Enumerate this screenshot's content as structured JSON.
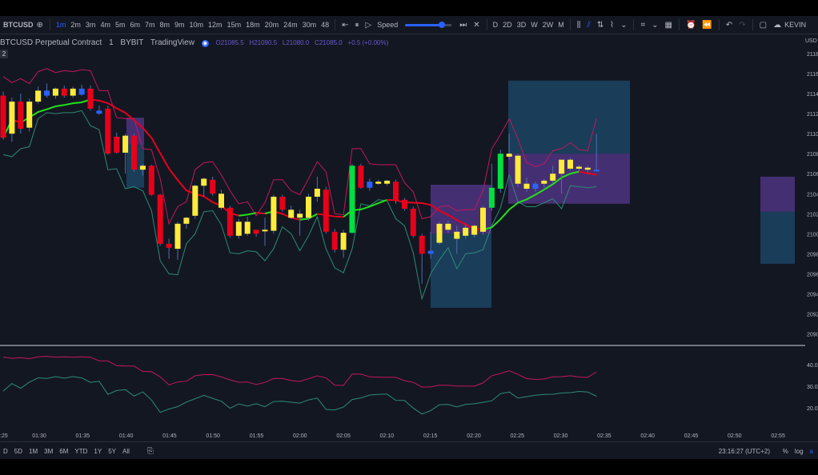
{
  "toolbar": {
    "symbol": "BTCUSD",
    "intervals": [
      "1m",
      "2m",
      "3m",
      "4m",
      "5m",
      "6m",
      "7m",
      "8m",
      "9m",
      "10m",
      "12m",
      "15m",
      "18m",
      "20m",
      "24m",
      "30m",
      "48"
    ],
    "active_interval": "1m",
    "speed_label": "Speed",
    "ranges_right": [
      "D",
      "2D",
      "3D",
      "W",
      "2W",
      "M"
    ],
    "account": "KEVIN"
  },
  "legend": {
    "title": "BTCUSD Perpetual Contract",
    "interval": "1",
    "exchange": "BYBIT",
    "source": "TradingView",
    "open": "O21085.5",
    "high": "H21090.5",
    "low": "L21080.0",
    "close": "C21085.0",
    "change": "+0.5 (+0.00%)",
    "pane_badge": "2"
  },
  "price_axis": {
    "currency": "USD",
    "ticks": [
      "2118",
      "2116",
      "2114",
      "2112",
      "2110",
      "2108",
      "2106",
      "2104",
      "2102",
      "2100",
      "2098",
      "2096",
      "2094",
      "2092",
      "2090"
    ]
  },
  "indicator_axis": {
    "ticks": [
      "40.0",
      "30.0",
      "20.0"
    ]
  },
  "time_axis": {
    "ticks": [
      ":25",
      "01:30",
      "01:35",
      "01:40",
      "01:45",
      "01:50",
      "01:55",
      "02:00",
      "02:05",
      "02:10",
      "02:15",
      "02:20",
      "02:25",
      "02:30",
      "02:35",
      "02:40",
      "02:45",
      "02:50",
      "02:55"
    ]
  },
  "bottom": {
    "ranges": [
      "D",
      "5D",
      "1M",
      "3M",
      "6M",
      "YTD",
      "1Y",
      "5Y",
      "All"
    ],
    "clock": "23:16:27 (UTC+2)",
    "percent": "%",
    "log": "log",
    "auto": "a"
  },
  "colors": {
    "background": "#131722",
    "candle_yellow": "#ffeb3b",
    "candle_red": "#e8001a",
    "candle_green": "#00e040",
    "candle_blue": "#2962ff",
    "ma_red": "#e6001c",
    "ma_green": "#22e01c",
    "band": "#c2185b",
    "band_lower": "#2e8b74",
    "box_blue": "#1e4f72",
    "box_purple": "#5b3a96"
  },
  "chart_data": {
    "type": "candlestick",
    "ylim": [
      2089,
      2120
    ],
    "times": [
      "01:25",
      "01:26",
      "01:27",
      "01:28",
      "01:29",
      "01:30",
      "01:31",
      "01:32",
      "01:33",
      "01:34",
      "01:35",
      "01:36",
      "01:37",
      "01:38",
      "01:39",
      "01:40",
      "01:41",
      "01:42",
      "01:43",
      "01:44",
      "01:45",
      "01:46",
      "01:47",
      "01:48",
      "01:49",
      "01:50",
      "01:51",
      "01:52",
      "01:53",
      "01:54",
      "01:55",
      "01:56",
      "01:57",
      "01:58",
      "01:59",
      "02:00",
      "02:01",
      "02:02",
      "02:03",
      "02:04",
      "02:05",
      "02:06",
      "02:07",
      "02:08",
      "02:09",
      "02:10",
      "02:11",
      "02:12",
      "02:13",
      "02:14",
      "02:15",
      "02:16",
      "02:17",
      "02:18",
      "02:19",
      "02:20",
      "02:21",
      "02:22",
      "02:23",
      "02:24",
      "02:25",
      "02:26",
      "02:27",
      "02:28",
      "02:29",
      "02:30",
      "02:31",
      "02:32",
      "02:33"
    ],
    "candles": [
      [
        2113.8,
        2114.2,
        2109.4,
        2109.6,
        "red"
      ],
      [
        2110,
        2113.6,
        2109.2,
        2113.2,
        "yellow"
      ],
      [
        2113.2,
        2114,
        2110,
        2110.5,
        "red"
      ],
      [
        2110.6,
        2113.5,
        2110.2,
        2113.2,
        "yellow"
      ],
      [
        2113.2,
        2114.7,
        2113.0,
        2114.3,
        "yellow"
      ],
      [
        2114.3,
        2115,
        2113.6,
        2113.8,
        "blue"
      ],
      [
        2113.8,
        2114.6,
        2113.5,
        2114.5,
        "yellow"
      ],
      [
        2114.5,
        2114.8,
        2113.6,
        2113.8,
        "red"
      ],
      [
        2113.8,
        2114.7,
        2113.6,
        2114.5,
        "yellow"
      ],
      [
        2114.5,
        2114.9,
        2113.8,
        2113.9,
        "blue"
      ],
      [
        2114.5,
        2114.8,
        2112.3,
        2112.5,
        "red"
      ],
      [
        2112.3,
        2112.8,
        2111.9,
        2112.0,
        "blue"
      ],
      [
        2112.5,
        2112.8,
        2107.9,
        2108.0,
        "red"
      ],
      [
        2109.7,
        2110.1,
        2108.0,
        2108.1,
        "red"
      ],
      [
        2108.1,
        2110.0,
        2106.0,
        2109.8,
        "yellow"
      ],
      [
        2109.8,
        2110.0,
        2106.2,
        2106.4,
        "red"
      ],
      [
        2106.4,
        2107.0,
        2105.8,
        2106.8,
        "yellow"
      ],
      [
        2106.8,
        2106.9,
        2103.8,
        2103.9,
        "red"
      ],
      [
        2103.9,
        2104.0,
        2098.8,
        2099.0,
        "red"
      ],
      [
        2099.0,
        2099.5,
        2097.5,
        2098.6,
        "red"
      ],
      [
        2098.5,
        2101.2,
        2097.4,
        2101.0,
        "yellow"
      ],
      [
        2101.0,
        2101.7,
        2100.5,
        2101.6,
        "yellow"
      ],
      [
        2101.8,
        2104.9,
        2101.5,
        2104.8,
        "yellow"
      ],
      [
        2104.8,
        2105.6,
        2103.7,
        2105.5,
        "yellow"
      ],
      [
        2105.4,
        2105.7,
        2103.8,
        2104.0,
        "red"
      ],
      [
        2104.0,
        2104.4,
        2102.4,
        2102.6,
        "yellow"
      ],
      [
        2102.6,
        2102.8,
        2099.6,
        2099.8,
        "red"
      ],
      [
        2099.8,
        2101.5,
        2099.5,
        2101.2,
        "yellow"
      ],
      [
        2101.2,
        2101.7,
        2099.8,
        2100.0,
        "yellow"
      ],
      [
        2100.0,
        2100.3,
        2099.7,
        2100.4,
        "red"
      ],
      [
        2100.4,
        2101.6,
        2098.8,
        2100.3,
        "yellow"
      ],
      [
        2100.3,
        2103.9,
        2100.0,
        2103.7,
        "yellow"
      ],
      [
        2103.7,
        2103.9,
        2102.2,
        2102.4,
        "red"
      ],
      [
        2102.4,
        2102.8,
        2101.5,
        2101.6,
        "yellow"
      ],
      [
        2101.6,
        2102.4,
        2099.8,
        2102.0,
        "yellow"
      ],
      [
        2101.6,
        2104.0,
        2101.3,
        2103.7,
        "yellow"
      ],
      [
        2103.7,
        2105.7,
        2103.2,
        2104.5,
        "yellow"
      ],
      [
        2104.4,
        2104.7,
        2100.0,
        2100.2,
        "red"
      ],
      [
        2100.2,
        2100.5,
        2098.1,
        2098.4,
        "red"
      ],
      [
        2098.4,
        2100.4,
        2097.6,
        2100.1,
        "yellow"
      ],
      [
        2100.1,
        2107.0,
        2100.0,
        2106.8,
        "green"
      ],
      [
        2106.8,
        2107.0,
        2104.5,
        2104.6,
        "red"
      ],
      [
        2104.6,
        2105.5,
        2104.3,
        2105.2,
        "blue"
      ],
      [
        2105.2,
        2105.4,
        2104.9,
        2105.0,
        "yellow"
      ],
      [
        2105.0,
        2105.4,
        2104.8,
        2105.3,
        "yellow"
      ],
      [
        2105.2,
        2105.4,
        2103.0,
        2103.3,
        "red"
      ],
      [
        2103.4,
        2103.6,
        2102.3,
        2102.5,
        "red"
      ],
      [
        2102.5,
        2102.7,
        2099.6,
        2099.8,
        "red"
      ],
      [
        2099.8,
        2100.0,
        2095.0,
        2098.0,
        "red"
      ],
      [
        2098.0,
        2100.2,
        2097.5,
        2098.3,
        "blue"
      ],
      [
        2099.1,
        2101.2,
        2098.9,
        2101.0,
        "yellow"
      ],
      [
        2101.0,
        2101.3,
        2100.1,
        2100.4,
        "yellow"
      ],
      [
        2099.5,
        2100.8,
        2098.0,
        2100.2,
        "yellow"
      ],
      [
        2099.8,
        2100.9,
        2099.5,
        2100.6,
        "yellow"
      ],
      [
        2099.9,
        2100.9,
        2099.6,
        2100.8,
        "yellow"
      ],
      [
        2100.2,
        2102.8,
        2099.9,
        2102.6,
        "yellow"
      ],
      [
        2102.6,
        2107.0,
        2102.3,
        2104.6,
        "green"
      ],
      [
        2104.5,
        2108.4,
        2104.1,
        2108.0,
        "green"
      ],
      [
        2108.0,
        2110.0,
        2107.4,
        2107.7,
        "yellow"
      ],
      [
        2107.8,
        2108.0,
        2104.7,
        2105.0,
        "yellow"
      ],
      [
        2105.0,
        2105.6,
        2104.2,
        2104.5,
        "yellow"
      ],
      [
        2104.5,
        2105.2,
        2104.2,
        2105.0,
        "blue"
      ],
      [
        2105.0,
        2105.5,
        2104.6,
        2105.3,
        "yellow"
      ],
      [
        2105.3,
        2106.8,
        2105.0,
        2106.0,
        "yellow"
      ],
      [
        2106.0,
        2107.0,
        2104.0,
        2107.4,
        "yellow"
      ],
      [
        2107.4,
        2107.6,
        2106.3,
        2106.5,
        "yellow"
      ],
      [
        2106.5,
        2106.9,
        2106.2,
        2106.7,
        "yellow"
      ],
      [
        2106.6,
        2106.8,
        2106.1,
        2106.4,
        "yellow"
      ],
      [
        2106.4,
        2110.0,
        2106.2,
        2106.3,
        "blue"
      ]
    ]
  }
}
